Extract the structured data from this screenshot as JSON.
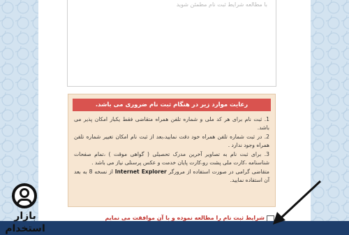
{
  "textarea": {
    "partial_text": "با مطالعه شرایط ثبت نام مطمئن شوید"
  },
  "notice": {
    "header": "رعایت موارد زیر در هنگام ثبت نام ضروری می باشد.",
    "item1": "1. ثبت نام برای هر کد ملی و شماره تلفن همراه متقاضی فقط یکبار امکان پذیر می باشد.",
    "item2": "2. در ثبت شماره تلفن همراه خود دقت نمایید،بعد از ثبت نام امکان تغییر شماره تلفن همراه وجود ندارد .",
    "item3": "3. برای ثبت نام به تصاویر آخرین مدرک تحصیلی ( گواهی موقت ) ،تمام صفحات شناسنامه ،کارت ملی پشت رو،کارت پایان خدمت و عکس پرسنلی نیاز می باشد .",
    "ie_note_pre": "متقاضی گرامی در صورت استفاده از مرورگر",
    "ie_name": "Internet Explorer",
    "ie_note_post": "از نسخه 8 به بعد آن استفاده نمایید."
  },
  "agreement": {
    "label": "شرایط ثبت نام را مطالعه نموده و با آن موافقت می نمایم"
  },
  "logo": {
    "text": "بازار استخدام"
  },
  "colors": {
    "header_red": "#d9534f",
    "notice_bg": "#f7e6d2",
    "bottom_bar": "#1d3d6b"
  }
}
